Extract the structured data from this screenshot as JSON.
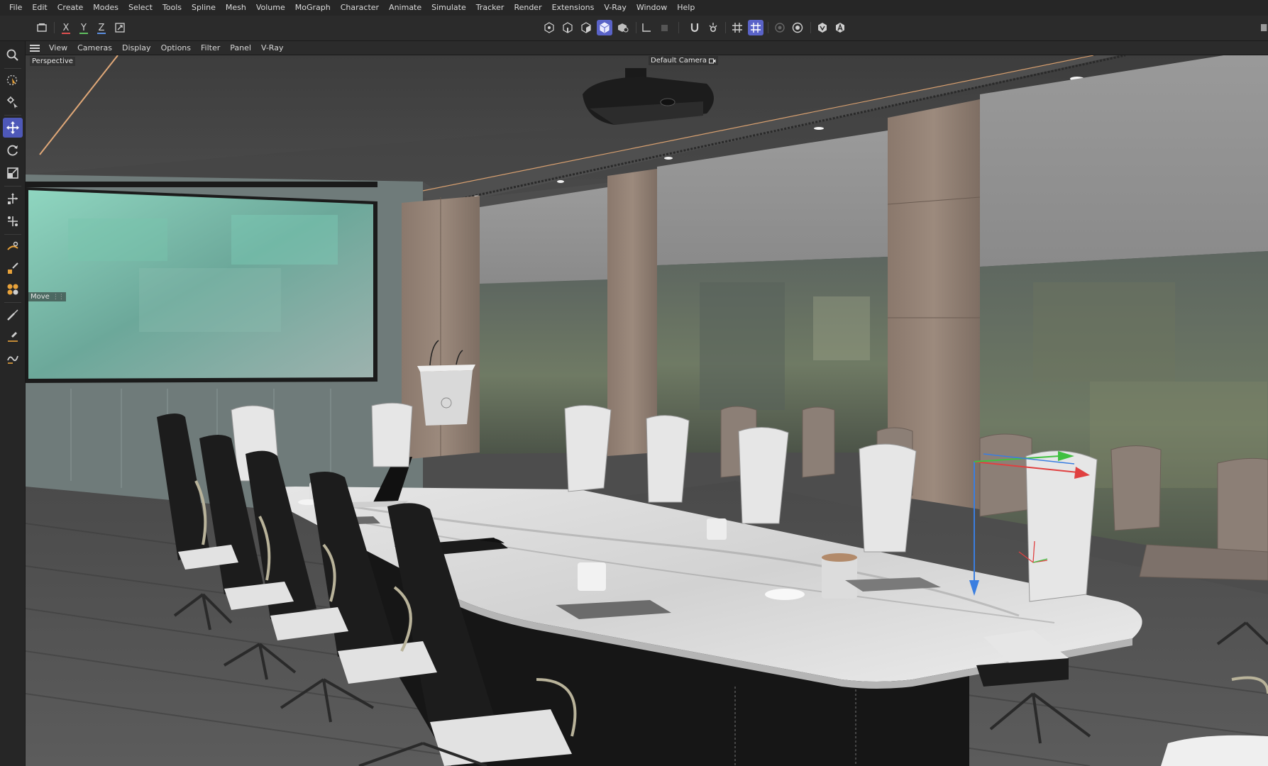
{
  "menubar": {
    "items": [
      "File",
      "Edit",
      "Create",
      "Modes",
      "Select",
      "Tools",
      "Spline",
      "Mesh",
      "Volume",
      "MoGraph",
      "Character",
      "Animate",
      "Simulate",
      "Tracker",
      "Render",
      "Extensions",
      "V-Ray",
      "Window",
      "Help"
    ]
  },
  "toolbar": {
    "axes": [
      "X",
      "Y",
      "Z"
    ],
    "axis_colors": [
      "#e05050",
      "#60c060",
      "#5a8de0"
    ],
    "accent": "#5a63c8",
    "icons": [
      "undo-stack-icon",
      "coordinate-system-icon",
      "points-mode-icon",
      "edges-mode-icon",
      "polygons-mode-icon",
      "object-mode-icon",
      "texture-mode-icon",
      "axis-mode-icon",
      "tweak-mode-icon",
      "snap-magnet-icon",
      "snap-settings-icon",
      "grid-icon",
      "workplane-icon",
      "render-region-icon",
      "render-settings-icon",
      "vray-icon",
      "vray-asset-icon"
    ]
  },
  "lefttools": {
    "icons": [
      "search-icon",
      "live-selection-icon",
      "selection-settings-icon",
      "move-icon",
      "rotate-icon",
      "scale-icon",
      "transform-icon",
      "soft-transform-icon",
      "magnet-icon",
      "brush-icon",
      "deformer-icon",
      "sculpt-icon",
      "pen-icon",
      "knife-icon",
      "spline-pen-icon"
    ]
  },
  "viewport_menu": {
    "items": [
      "View",
      "Cameras",
      "Display",
      "Options",
      "Filter",
      "Panel",
      "V-Ray"
    ]
  },
  "viewport": {
    "projection_label": "Perspective",
    "camera_label": "Default Camera",
    "tool_label": "Move"
  }
}
